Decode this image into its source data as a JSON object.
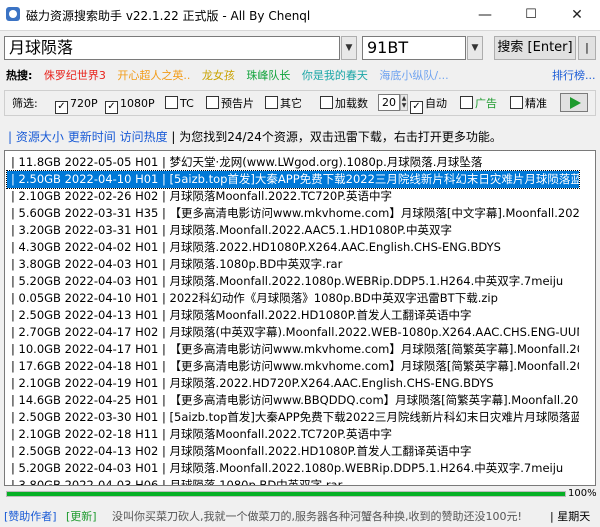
{
  "window": {
    "title": "磁力资源搜索助手 v22.1.22 正式版 - All By Chenql",
    "min_symbol": "—",
    "max_symbol": "☐",
    "close_symbol": "✕"
  },
  "search": {
    "keyword": "月球陨落",
    "site": "91BT",
    "search_label": "搜索 [Enter]",
    "more_label": "|"
  },
  "hot": {
    "label": "热搜:",
    "items": [
      {
        "text": "侏罗纪世界3",
        "color": "#e8231c"
      },
      {
        "text": "开心超人之英..",
        "color": "#f29b16"
      },
      {
        "text": "龙女孩",
        "color": "#c9a200"
      },
      {
        "text": "珠峰队长",
        "color": "#11a33b"
      },
      {
        "text": "你是我的春天",
        "color": "#1aa6a6"
      },
      {
        "text": "海底小纵队/...",
        "color": "#6fa3f0"
      }
    ],
    "rank_label": "排行榜..."
  },
  "filters": {
    "label": "筛选:",
    "opt_720p": "720P",
    "opt_1080p": "1080P",
    "opt_tc": "TC",
    "opt_trailer": "预告片",
    "opt_other": "其它",
    "opt_load_count": "加载数",
    "load_count_value": "20",
    "opt_auto": "自动",
    "opt_ads": "广告",
    "opt_precise": "精准",
    "checked_720p": "✓",
    "checked_1080p": "✓",
    "checked_auto": "✓"
  },
  "sort": {
    "prefix": "|",
    "by_size": "资源大小",
    "by_time": "更新时间",
    "by_popularity": "访问热度",
    "info": "| 为您找到24/24个资源，双击迅雷下载，右击打开更多功能。"
  },
  "results": [
    "| 11.8GB 2022-05-05 H01 | 梦幻天堂·龙网(www.LWgod.org).1080p.月球陨落.月球坠落",
    "| 2.50GB 2022-04-10 H01 | [5aizb.top首发]大秦APP免费下载2022三月院线新片科幻末日灾难片月球陨落蓝",
    "| 2.10GB 2022-02-26 H02 | 月球陨落Moonfall.2022.TC720P.英语中字",
    "| 5.60GB 2022-03-31 H35 | 【更多高清电影访问www.mkvhome.com】月球陨落[中文字幕].Moonfall.2022",
    "| 3.20GB 2022-03-31 H01 | 月球陨落.Moonfall.2022.AAC5.1.HD1080P.中英双字",
    "| 4.30GB 2022-04-02 H01 | 月球陨落.2022.HD1080P.X264.AAC.English.CHS-ENG.BDYS",
    "| 3.80GB 2022-04-03 H01 | 月球陨落.1080p.BD中英双字.rar",
    "| 5.20GB 2022-04-03 H01 | 月球陨落.Moonfall.2022.1080p.WEBRip.DDP5.1.H264.中英双字.7meiju",
    "| 0.05GB 2022-04-10 H01 | 2022科幻动作《月球陨落》1080p.BD中英双字迅雷BT下载.zip",
    "| 2.50GB 2022-04-13 H01 | 月球陨落Moonfall.2022.HD1080P.首发人工翻译英语中字",
    "| 2.70GB 2022-04-17 H02 | 月球陨落(中英双字幕).Moonfall.2022.WEB-1080p.X264.AAC.CHS.ENG-UUM",
    "| 10.0GB 2022-04-17 H01 | 【更多高清电影访问www.mkvhome.com】月球陨落[简繁英字幕].Moonfall.20",
    "| 17.6GB 2022-04-18 H01 | 【更多高清电影访问www.mkvhome.com】月球陨落[简繁英字幕].Moonfall.20",
    "| 2.10GB 2022-04-19 H01 | 月球陨落.2022.HD720P.X264.AAC.English.CHS-ENG.BDYS",
    "| 14.6GB 2022-04-25 H01 | 【更多高清电影访问www.BBQDDQ.com】月球陨落[简繁英字幕].Moonfall.2022",
    "| 2.50GB 2022-03-30 H01 | [5aizb.top首发]大秦APP免费下载2022三月院线新片科幻末日灾难片月球陨落蓝",
    "| 2.10GB 2022-02-18 H11 | 月球陨落Moonfall.2022.TC720P.英语中字",
    "| 2.50GB 2022-04-13 H02 | 月球陨落Moonfall.2022.HD1080P.首发人工翻译英语中字",
    "| 5.20GB 2022-04-03 H01 | 月球陨落.Moonfall.2022.1080p.WEBRip.DDP5.1.H264.中英双字.7meiju",
    "| 3.80GB 2022-04-03 H06 | 月球陨落.1080p.BD中英双字.rar"
  ],
  "selected_index": 1,
  "progress": {
    "percent": 100,
    "text": "100%",
    "color": "#06b025"
  },
  "status": {
    "sponsor": "[赞助作者]",
    "update": "[更新]",
    "message": "没叫你买菜刀砍人,我就一个做菜刀的,服务器各种河蟹各种换,收到的赞助还没100元!",
    "weekday": "| 星期天"
  },
  "colors": {
    "selection": "#0078d7",
    "link": "#1a5bd6",
    "green": "#1f9b2f"
  }
}
